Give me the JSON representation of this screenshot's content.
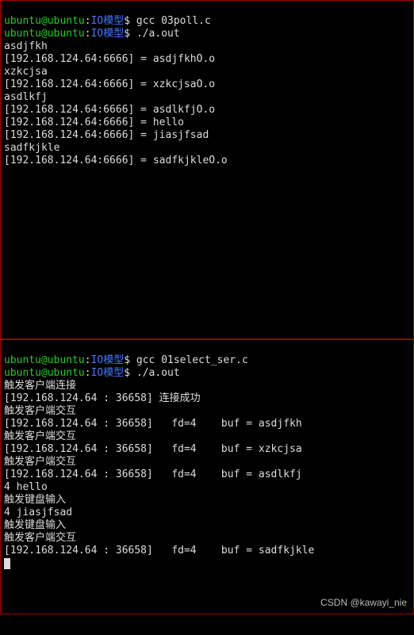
{
  "prompt": {
    "user": "ubuntu@ubuntu",
    "sep": ":",
    "path": "IO模型",
    "dollar": "$"
  },
  "top": {
    "cmd1": " gcc 03poll.c",
    "cmd2": " ./a.out",
    "lines": [
      "asdjfkh",
      "[192.168.124.64:6666] = asdjfkhO.o",
      "xzkcjsa",
      "[192.168.124.64:6666] = xzkcjsaO.o",
      "asdlkfj",
      "[192.168.124.64:6666] = asdlkfjO.o",
      "[192.168.124.64:6666] = hello",
      "[192.168.124.64:6666] = jiasjfsad",
      "sadfkjkle",
      "[192.168.124.64:6666] = sadfkjkleO.o"
    ]
  },
  "bottom": {
    "cmd1": " gcc 01select_ser.c",
    "cmd2": " ./a.out",
    "lines": [
      "触发客户端连接",
      "[192.168.124.64 : 36658] 连接成功",
      "触发客户端交互",
      "[192.168.124.64 : 36658]   fd=4    buf = asdjfkh",
      "触发客户端交互",
      "[192.168.124.64 : 36658]   fd=4    buf = xzkcjsa",
      "触发客户端交互",
      "[192.168.124.64 : 36658]   fd=4    buf = asdlkfj",
      "4 hello",
      "触发键盘输入",
      "4 jiasjfsad",
      "触发键盘输入",
      "触发客户端交互",
      "[192.168.124.64 : 36658]   fd=4    buf = sadfkjkle"
    ]
  },
  "watermark": "CSDN @kawayi_nie"
}
